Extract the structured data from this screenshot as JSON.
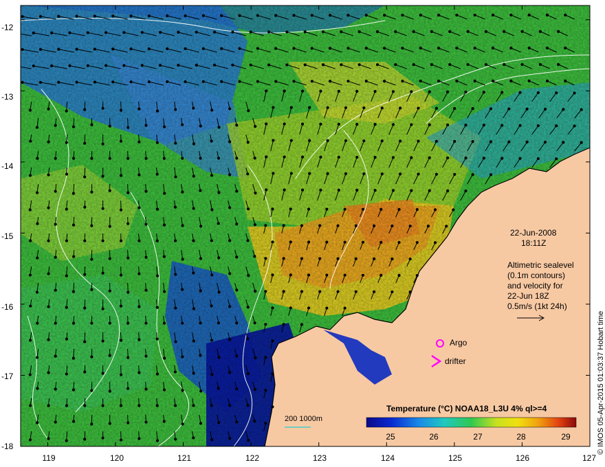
{
  "map": {
    "lat_labels": [
      "-12",
      "-13",
      "-14",
      "-15",
      "-16",
      "-17",
      "-18"
    ],
    "lon_labels": [
      "119",
      "120",
      "121",
      "122",
      "123",
      "124",
      "125",
      "126",
      "127"
    ],
    "lat_range": [
      -18,
      -11.8
    ],
    "lon_range": [
      118.6,
      127
    ]
  },
  "annotation": {
    "date": "22-Jun-2008",
    "time": "18:11Z",
    "lines": [
      "Altimetric sealevel",
      "(0.1m contours)",
      "and velocity for",
      "22-Jun 18Z",
      "0.5m/s (1kt 24h)"
    ]
  },
  "markers": {
    "argo_label": "Argo",
    "drifter_label": "drifter",
    "argo_color": "#ff00ff",
    "drifter_color": "#ff00ff"
  },
  "colorbar": {
    "title": "Temperature (°C) NOAA18_L3U 4% ql>=4",
    "ticks": [
      "25",
      "26",
      "27",
      "28",
      "29"
    ],
    "range": [
      24.3,
      29.3
    ]
  },
  "depth_legend": {
    "label": "200  1000m"
  },
  "credit": "© IMOS 05-Apr-2015 01:03:37 Hobart time",
  "colors": {
    "land": "#f7c9a3",
    "contour": "#ffffff",
    "arrow": "#000000"
  }
}
